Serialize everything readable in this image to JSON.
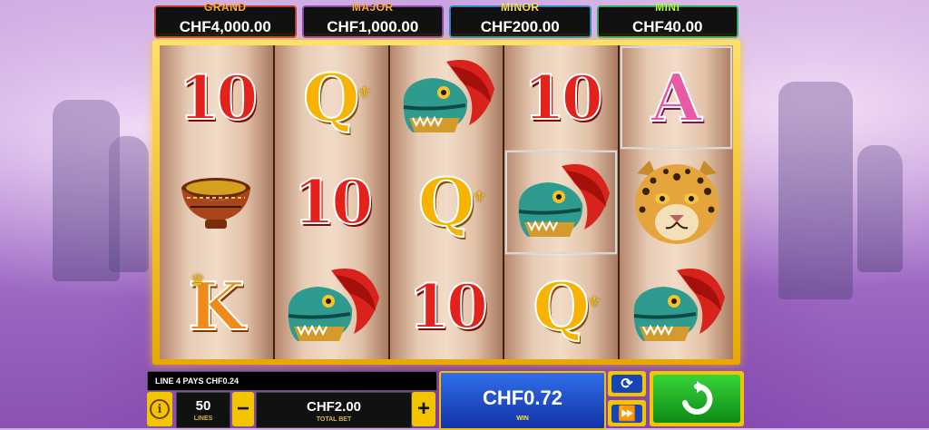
{
  "jackpots": [
    {
      "label": "GRAND",
      "value": "CHF4,000.00"
    },
    {
      "label": "MAJOR",
      "value": "CHF1,000.00"
    },
    {
      "label": "MINOR",
      "value": "CHF200.00"
    },
    {
      "label": "MINI",
      "value": "CHF40.00"
    }
  ],
  "reels": [
    [
      "10",
      "bowl",
      "K"
    ],
    [
      "Q",
      "10",
      "serpent-head"
    ],
    [
      "serpent-head",
      "Q",
      "10"
    ],
    [
      "10",
      "serpent-head",
      "Q"
    ],
    [
      "A",
      "jaguar",
      "serpent-head"
    ]
  ],
  "symbols": {
    "ten": "10",
    "queen": "Q",
    "ace": "A",
    "king": "K"
  },
  "footer": {
    "message": "LINE 4 PAYS CHF0.24",
    "lines_value": "50",
    "lines_label": "LINES",
    "bet_value": "CHF2.00",
    "bet_label": "TOTAL BET",
    "win_value": "CHF0.72",
    "win_label": "WIN",
    "minus": "−",
    "plus": "+",
    "info_glyph": "i",
    "auto_glyph": "⟳",
    "turbo_glyph": "⏩"
  },
  "colors": {
    "frame": "#f2c100",
    "win_panel": "#1f4fd0",
    "spin": "#1ea728"
  }
}
